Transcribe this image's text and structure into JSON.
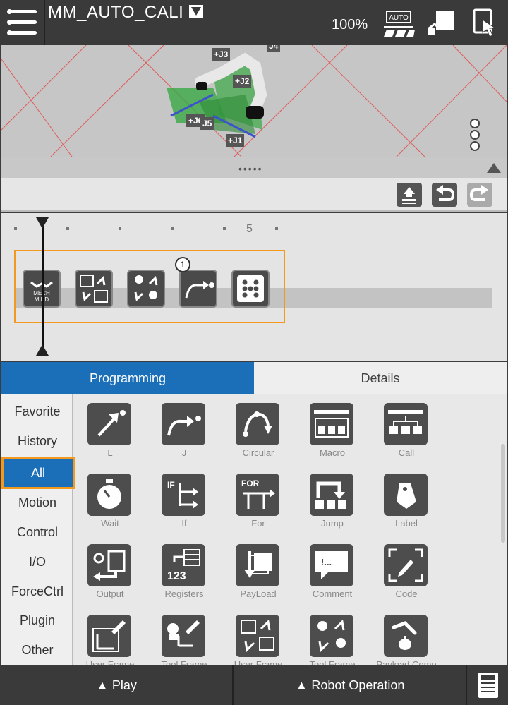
{
  "header": {
    "program_name": "MM_AUTO_CALI",
    "speed": "100%"
  },
  "viewport": {
    "joint_labels": [
      "+J3",
      "+J2",
      "+J6",
      "J5",
      "+J1",
      "J4"
    ]
  },
  "timeline": {
    "ruler_number": "5",
    "block_number": "1"
  },
  "tabs": {
    "programming": "Programming",
    "details": "Details"
  },
  "categories": [
    "Favorite",
    "History",
    "All",
    "Motion",
    "Control",
    "I/O",
    "ForceCtrl",
    "Plugin",
    "Other"
  ],
  "commands": [
    "L",
    "J",
    "Circular",
    "Macro",
    "Call",
    "Wait",
    "If",
    "For",
    "Jump",
    "Label",
    "Output",
    "Registers",
    "PayLoad",
    "Comment",
    "Code",
    "User Frame",
    "Tool Frame",
    "User Frame",
    "Tool Frame",
    "Payload Comp"
  ],
  "icon_text": {
    "mech_mind": "MECH MIND",
    "if": "IF",
    "for": "FOR",
    "registers": "123",
    "comment": "!..."
  },
  "bottom": {
    "play": "▲ Play",
    "robot_operation": "▲ Robot Operation"
  },
  "colors": {
    "accent_blue": "#1a6fb8",
    "selection_orange": "#f39a1e"
  }
}
